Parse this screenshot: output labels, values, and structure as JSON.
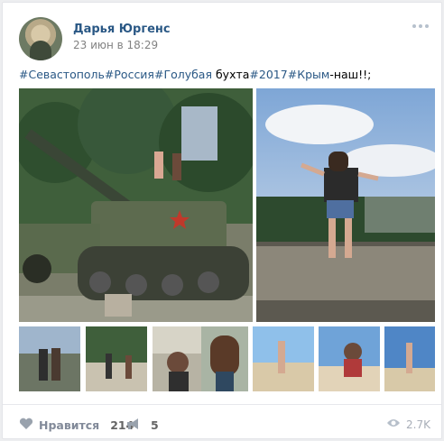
{
  "post": {
    "author": "Дарья Юргенс",
    "date": "23 июн в 18:29",
    "text_parts": [
      {
        "text": "#Севастополь",
        "tag": true
      },
      {
        "text": "#Россия",
        "tag": true
      },
      {
        "text": "#Голубая",
        "tag": true
      },
      {
        "text": " бухта",
        "tag": false
      },
      {
        "text": "#2017",
        "tag": true
      },
      {
        "text": "#Крым",
        "tag": true
      },
      {
        "text": "-наш!!;",
        "tag": false
      }
    ]
  },
  "icons": {
    "more": "more-dots-icon",
    "like": "heart-icon",
    "share": "megaphone-icon",
    "views": "eye-icon"
  },
  "actions": {
    "like_label": "Нравится",
    "like_count": "214",
    "share_count": "5",
    "views": "2.7K"
  },
  "colors": {
    "link": "#2a5885",
    "muted": "#828282",
    "bg": "#edeef0"
  }
}
